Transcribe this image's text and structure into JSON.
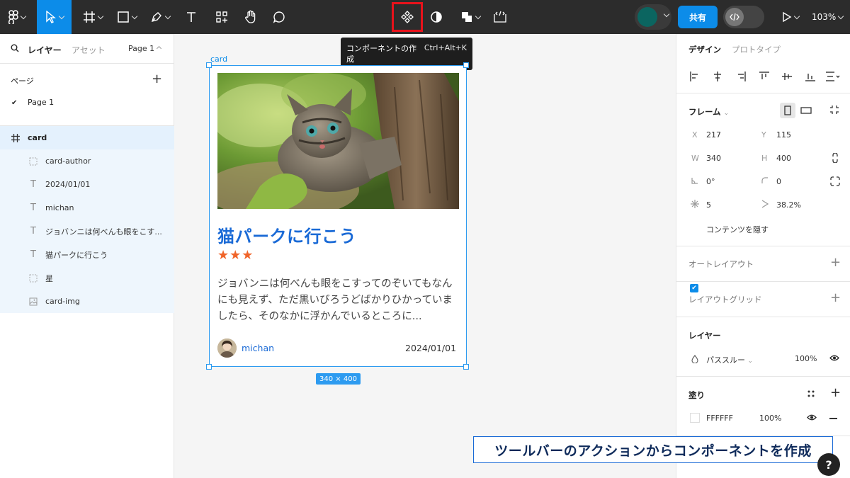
{
  "toolbar": {
    "share_label": "共有",
    "zoom": "103%",
    "tooltip_title": "コンポーネントの作成",
    "tooltip_shortcut": "Ctrl+Alt+K",
    "accent": "#0c8ce9",
    "highlight": "#e8121b"
  },
  "left_panel": {
    "tab_layers": "レイヤー",
    "tab_assets": "アセット",
    "current_page": "Page 1",
    "pages_header": "ページ",
    "pages": [
      "Page 1"
    ],
    "layers": [
      {
        "name": "card",
        "icon": "frame-icon"
      },
      {
        "name": "card-author",
        "icon": "dashed-frame-icon"
      },
      {
        "name": "2024/01/01",
        "icon": "text-icon"
      },
      {
        "name": "michan",
        "icon": "text-icon"
      },
      {
        "name": "ジョバンニは何べんも眼をこす...",
        "icon": "text-icon"
      },
      {
        "name": "猫パークに行こう",
        "icon": "text-icon"
      },
      {
        "name": "星",
        "icon": "dashed-frame-icon"
      },
      {
        "name": "card-img",
        "icon": "image-icon"
      }
    ]
  },
  "canvas": {
    "frame_label": "card",
    "size_badge": "340 × 400",
    "card": {
      "title": "猫パークに行こう",
      "stars": "★★★",
      "description": "ジョバンニは何べんも眼をこすってのぞいてもなんにも見えず、ただ黒いびろうどばかりひかっていましたら、そのなかに浮かんでいるところに...",
      "author": "michan",
      "date": "2024/01/01"
    }
  },
  "right_panel": {
    "tab_design": "デザイン",
    "tab_prototype": "プロトタイプ",
    "frame_label": "フレーム",
    "x_label": "X",
    "x": "217",
    "y_label": "Y",
    "y": "115",
    "w_label": "W",
    "w": "340",
    "h_label": "H",
    "h": "400",
    "rotation": "0°",
    "radius": "0",
    "corner_count": "5",
    "ratio": "38.2%",
    "clip_content": "コンテンツを隠す",
    "auto_layout": "オートレイアウト",
    "layout_grid": "レイアウトグリッド",
    "layer_title": "レイヤー",
    "blend_mode": "パススルー",
    "opacity": "100%",
    "fill_title": "塗り",
    "fill_hex": "FFFFFF",
    "fill_opacity": "100%"
  },
  "caption": "ツールバーのアクションからコンポーネントを作成"
}
